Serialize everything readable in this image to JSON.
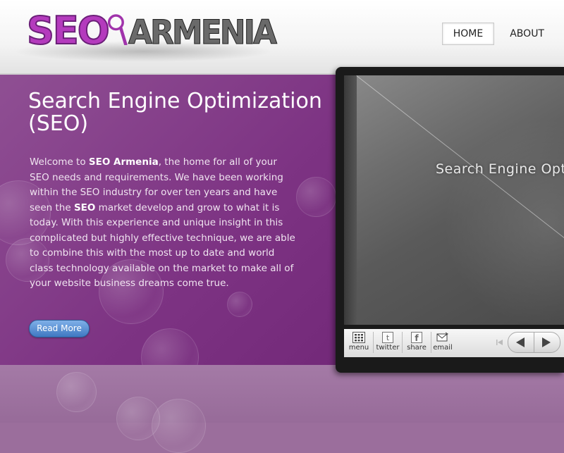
{
  "header": {
    "logo": {
      "part1": "SEO",
      "part2": "ARMENIA"
    },
    "nav": [
      {
        "label": "HOME",
        "active": true
      },
      {
        "label": "ABOUT",
        "active": false
      }
    ]
  },
  "hero": {
    "title": "Search Engine Optimization (SEO)",
    "paragraph": {
      "p1": "Welcome to ",
      "b1": "SEO Armenia",
      "p2": ", the home for all of your SEO needs and requirements. We have been working within the SEO industry for over ten years and have seen the ",
      "b2": "SEO",
      "p3": " market develop and grow to what it is today. With this experience and unique insight in this complicated but highly effective technique, we are able to combine this with the most up to date and world class technology available on the market to make all of your website business dreams come true."
    },
    "read_more_label": "Read More"
  },
  "player": {
    "screen_text": "Search Engine Opti",
    "controls": [
      {
        "label": "menu",
        "icon": "grid-icon"
      },
      {
        "label": "twitter",
        "icon": "twitter-icon"
      },
      {
        "label": "share",
        "icon": "facebook-icon"
      },
      {
        "label": "email",
        "icon": "envelope-icon"
      }
    ]
  },
  "colors": {
    "hero_purple": "#7d3383",
    "logo_purple": "#b43bbd",
    "button_blue": "#3f78c2"
  }
}
